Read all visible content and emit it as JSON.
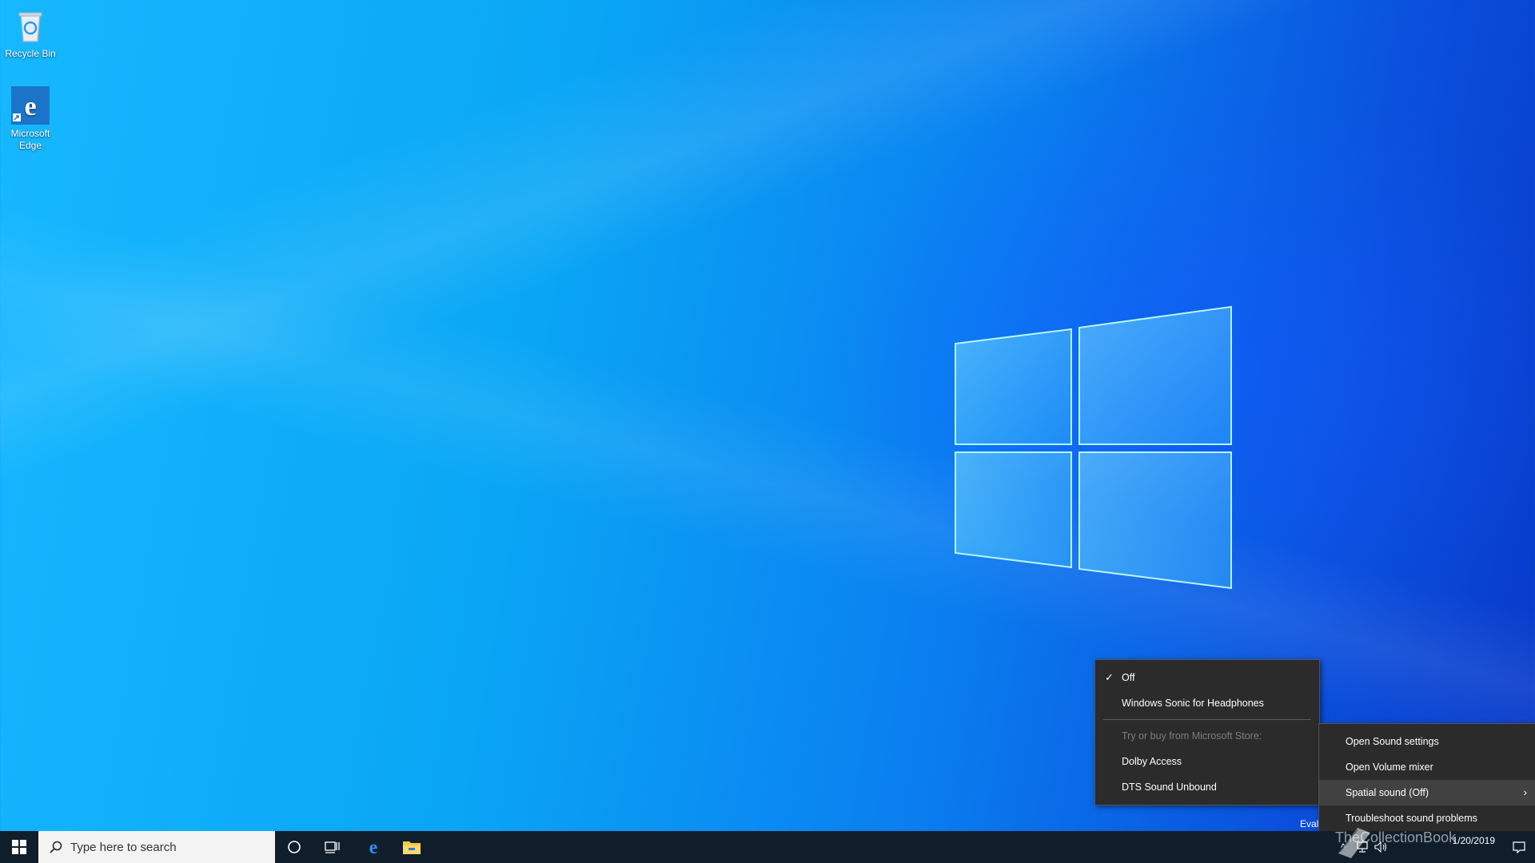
{
  "desktop": {
    "icons": [
      {
        "label": "Recycle Bin",
        "icon": "recycle-bin-icon"
      },
      {
        "label": "Microsoft Edge",
        "icon": "edge-icon"
      }
    ]
  },
  "spatial_submenu": {
    "items": [
      {
        "label": "Off",
        "checked": true
      },
      {
        "label": "Windows Sonic for Headphones"
      },
      {
        "label": "Try or buy from Microsoft Store:",
        "disabled": true
      },
      {
        "label": "Dolby Access"
      },
      {
        "label": "DTS Sound Unbound"
      }
    ]
  },
  "sound_menu": {
    "items": [
      {
        "label": "Open Sound settings"
      },
      {
        "label": "Open Volume mixer"
      },
      {
        "label": "Spatial sound (Off)",
        "has_submenu": true
      },
      {
        "label": "Troubleshoot sound problems"
      }
    ]
  },
  "taskbar": {
    "search_placeholder": "Type here to search",
    "pinned": [
      "cortana-icon",
      "task-view-icon",
      "edge-icon",
      "file-explorer-icon"
    ],
    "clock": {
      "time": "",
      "date": "1/20/2019"
    },
    "eval_text": "Eval"
  },
  "watermark": "TheCollectionBook",
  "colors": {
    "menu_bg": "#2b2b2b",
    "taskbar_bg": "#101e2c",
    "accent": "#0a7ff0"
  }
}
